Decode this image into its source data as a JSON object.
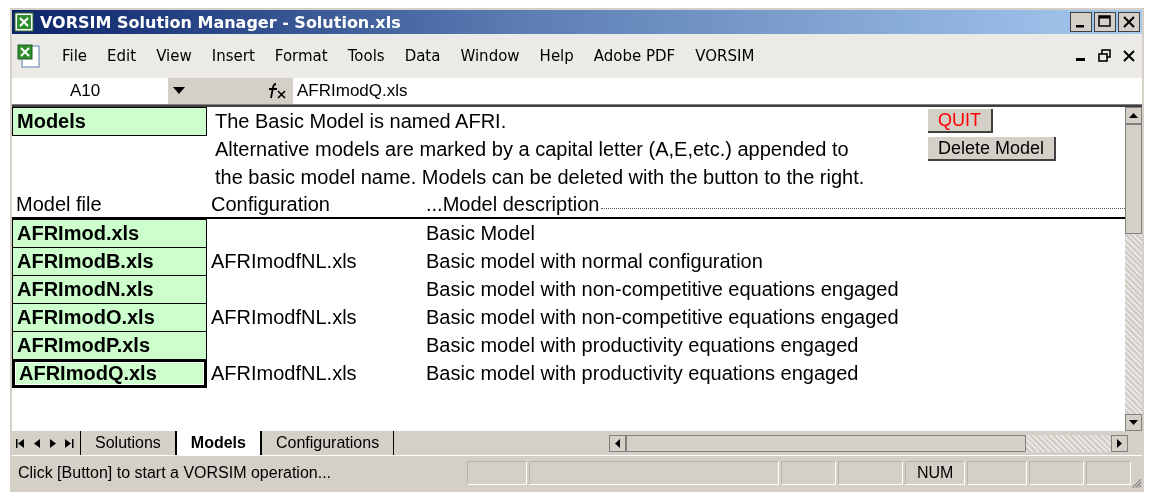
{
  "window": {
    "title": "VORSIM Solution Manager - Solution.xls"
  },
  "menu": [
    "File",
    "Edit",
    "View",
    "Insert",
    "Format",
    "Tools",
    "Data",
    "Window",
    "Help",
    "Adobe PDF",
    "VORSIM"
  ],
  "formula_bar": {
    "name_box": "A10",
    "formula": "AFRImodQ.xls"
  },
  "sheet": {
    "title": "Models",
    "notes": [
      "The Basic Model is named AFRI.",
      "Alternative models are marked by a capital letter (A,E,etc.) appended to",
      "the basic model name.  Models can be deleted with the button to the right."
    ],
    "buttons": [
      {
        "label": "QUIT",
        "kind": "alert"
      },
      {
        "label": "Delete Model",
        "kind": "normal"
      }
    ],
    "columns": [
      "Model file",
      "Configuration",
      "...Model description"
    ],
    "rows": [
      {
        "file": "AFRImod.xls",
        "configuration": "",
        "description": "Basic Model",
        "selected": false
      },
      {
        "file": "AFRImodB.xls",
        "configuration": "AFRImodfNL.xls",
        "description": "Basic model with normal configuration",
        "selected": false
      },
      {
        "file": "AFRImodN.xls",
        "configuration": "",
        "description": "Basic model with non-competitive equations engaged",
        "selected": false
      },
      {
        "file": "AFRImodO.xls",
        "configuration": "AFRImodfNL.xls",
        "description": "Basic model with non-competitive equations engaged",
        "selected": false
      },
      {
        "file": "AFRImodP.xls",
        "configuration": "",
        "description": "Basic model with productivity equations engaged",
        "selected": false
      },
      {
        "file": "AFRImodQ.xls",
        "configuration": "AFRImodfNL.xls",
        "description": "Basic model with productivity equations engaged",
        "selected": true
      }
    ]
  },
  "tabs": [
    {
      "label": "Solutions",
      "selected": false
    },
    {
      "label": "Models",
      "selected": true
    },
    {
      "label": "Configurations",
      "selected": false
    }
  ],
  "status_bar": {
    "message": "Click [Button] to start a VORSIM operation...",
    "indicator": "NUM"
  }
}
